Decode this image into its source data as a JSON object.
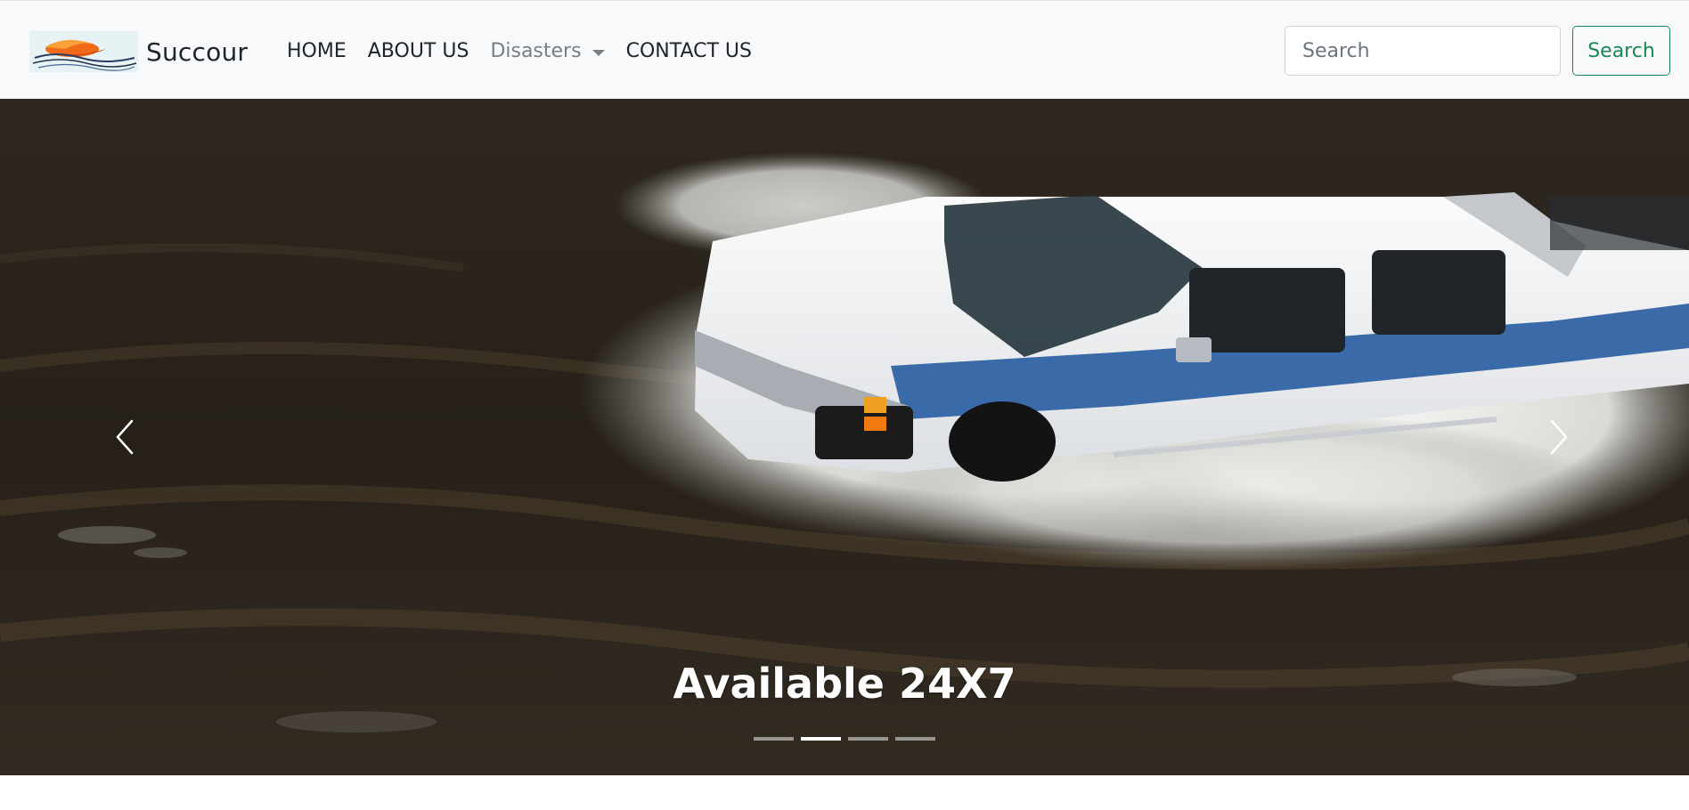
{
  "brand": {
    "name": "Succour",
    "logo_icon": "wave-logo-icon"
  },
  "nav": {
    "items": [
      {
        "label": "HOME",
        "muted": false
      },
      {
        "label": "ABOUT US",
        "muted": false
      },
      {
        "label": "Disasters",
        "muted": true,
        "dropdown": true
      },
      {
        "label": "CONTACT US",
        "muted": false
      }
    ]
  },
  "search": {
    "placeholder": "Search",
    "button_label": "Search"
  },
  "carousel": {
    "caption": "Available 24X7",
    "slide_count": 4,
    "active_index": 1,
    "prev_icon": "chevron-left-icon",
    "next_icon": "chevron-right-icon"
  },
  "colors": {
    "navbar_bg": "#f8f9fa",
    "link": "#212529",
    "muted_link": "#777f87",
    "search_button": "#198754"
  }
}
